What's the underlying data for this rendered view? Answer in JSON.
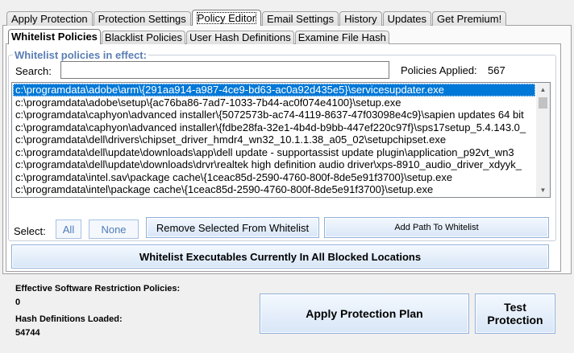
{
  "main_tabs": [
    {
      "label": "Apply Protection"
    },
    {
      "label": "Protection Settings"
    },
    {
      "label": "Policy Editor"
    },
    {
      "label": "Email Settings"
    },
    {
      "label": "History"
    },
    {
      "label": "Updates"
    },
    {
      "label": "Get Premium!"
    }
  ],
  "active_main_tab": "Policy Editor",
  "sub_tabs": [
    {
      "label": "Whitelist Policies"
    },
    {
      "label": "Blacklist Policies"
    },
    {
      "label": "User Hash Definitions"
    },
    {
      "label": "Examine File Hash"
    }
  ],
  "active_sub_tab": "Whitelist Policies",
  "whitelist": {
    "group_title": "Whitelist policies in effect:",
    "search_label": "Search:",
    "search_value": "",
    "applied_label": "Policies Applied:",
    "applied_count": "567",
    "items": [
      "c:\\programdata\\adobe\\arm\\{291aa914-a987-4ce9-bd63-ac0a92d435e5}\\servicesupdater.exe",
      "c:\\programdata\\adobe\\setup\\{ac76ba86-7ad7-1033-7b44-ac0f074e4100}\\setup.exe",
      "c:\\programdata\\caphyon\\advanced installer\\{5072573b-ac74-4119-8637-47f03098e4c9}\\sapien updates 64 bit",
      "c:\\programdata\\caphyon\\advanced installer\\{fdbe28fa-32e1-4b4d-b9bb-447ef220c97f}\\sps17setup_5.4.143.0_",
      "c:\\programdata\\dell\\drivers\\chipset_driver_hmdr4_wn32_10.1.1.38_a05_02\\setupchipset.exe",
      "c:\\programdata\\dell\\update\\downloads\\app\\dell update - supportassist update plugin\\application_p92vt_wn3",
      "c:\\programdata\\dell\\update\\downloads\\drvr\\realtek high definition audio driver\\xps-8910_audio_driver_xdyyk_",
      "c:\\programdata\\intel.sav\\package cache\\{1ceac85d-2590-4760-800f-8de5e91f3700}\\setup.exe",
      "c:\\programdata\\intel\\package cache\\{1ceac85d-2590-4760-800f-8de5e91f3700}\\setup.exe"
    ],
    "selected_index": 0,
    "select_label": "Select:",
    "all_label": "All",
    "none_label": "None",
    "remove_label": "Remove Selected From Whitelist",
    "add_label": "Add Path To Whitelist",
    "whitelist_all_label": "Whitelist Executables Currently In All Blocked Locations"
  },
  "status": {
    "srp_label": "Effective Software Restriction Policies:",
    "srp_value": "0",
    "hash_label": "Hash Definitions Loaded:",
    "hash_value": "54744"
  },
  "actions": {
    "apply_label": "Apply Protection Plan",
    "test_line1": "Test",
    "test_line2": "Protection"
  },
  "icons": {
    "scroll_up": "scroll-up-arrow-icon",
    "scroll_down": "scroll-down-arrow-icon"
  },
  "colors": {
    "selection": "#0078d7",
    "group_title": "#5a7eb3"
  }
}
